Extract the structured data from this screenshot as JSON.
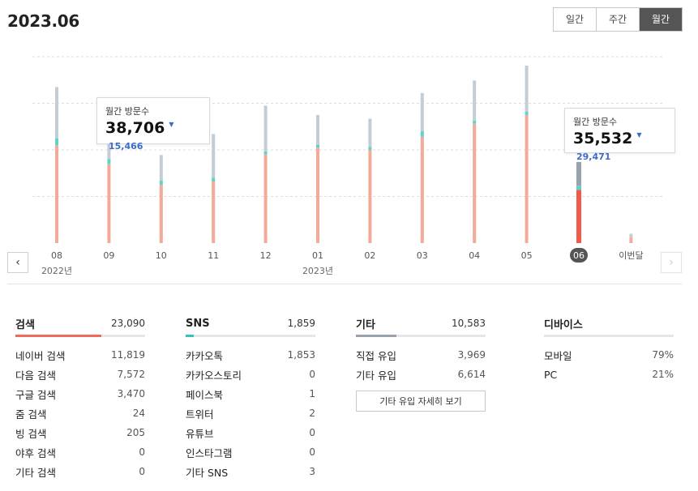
{
  "header": {
    "title": "2023.06"
  },
  "period_tabs": [
    {
      "label": "일간",
      "active": false
    },
    {
      "label": "주간",
      "active": false
    },
    {
      "label": "월간",
      "active": true
    }
  ],
  "chart_data": {
    "type": "bar",
    "title": "",
    "categories": [
      "08",
      "09",
      "10",
      "11",
      "12",
      "01",
      "02",
      "03",
      "04",
      "05",
      "06",
      "이번달"
    ],
    "year_labels": [
      {
        "index": 0,
        "label": "2022년"
      },
      {
        "index": 5,
        "label": "2023년"
      }
    ],
    "series": [
      {
        "name": "검색",
        "color": "#f2aa9a",
        "values": [
          21000,
          17000,
          12500,
          13200,
          19000,
          20500,
          20000,
          22800,
          25600,
          27500,
          11400,
          1200
        ]
      },
      {
        "name": "SNS",
        "color": "#5fd3c8",
        "values": [
          1500,
          1000,
          900,
          800,
          700,
          600,
          600,
          1200,
          700,
          700,
          900,
          0
        ]
      },
      {
        "name": "기타",
        "color": "#c5cdd4",
        "values": [
          11000,
          3500,
          5500,
          9400,
          9800,
          6400,
          6100,
          8200,
          8600,
          9900,
          5100,
          800
        ]
      }
    ],
    "selected_index": 10,
    "selected_color": "#f05a48",
    "ylim": [
      0,
      40000
    ],
    "grid": true,
    "tooltips": [
      {
        "index": 1,
        "label": "월간 방문수",
        "value": "38,706",
        "change": "15,466"
      },
      {
        "index": 10,
        "label": "월간 방문수",
        "value": "35,532",
        "change": "29,471"
      }
    ]
  },
  "stats": {
    "search": {
      "title": "검색",
      "total": "23,090",
      "color": "#f06a5a",
      "items": [
        {
          "name": "네이버 검색",
          "value": "11,819"
        },
        {
          "name": "다음 검색",
          "value": "7,572"
        },
        {
          "name": "구글 검색",
          "value": "3,470"
        },
        {
          "name": "줌 검색",
          "value": "24"
        },
        {
          "name": "빙 검색",
          "value": "205"
        },
        {
          "name": "야후 검색",
          "value": "0"
        },
        {
          "name": "기타 검색",
          "value": "0"
        }
      ]
    },
    "sns": {
      "title": "SNS",
      "total": "1,859",
      "color": "#33c4b8",
      "items": [
        {
          "name": "카카오톡",
          "value": "1,853"
        },
        {
          "name": "카카오스토리",
          "value": "0"
        },
        {
          "name": "페이스북",
          "value": "1"
        },
        {
          "name": "트위터",
          "value": "2"
        },
        {
          "name": "유튜브",
          "value": "0"
        },
        {
          "name": "인스타그램",
          "value": "0"
        },
        {
          "name": "기타 SNS",
          "value": "3"
        }
      ]
    },
    "etc": {
      "title": "기타",
      "total": "10,583",
      "color": "#9aa3ab",
      "items": [
        {
          "name": "직접 유입",
          "value": "3,969"
        },
        {
          "name": "기타 유입",
          "value": "6,614"
        }
      ],
      "button": "기타 유입 자세히 보기"
    },
    "device": {
      "title": "디바이스",
      "items": [
        {
          "name": "모바일",
          "value": "79%"
        },
        {
          "name": "PC",
          "value": "21%"
        }
      ]
    }
  }
}
